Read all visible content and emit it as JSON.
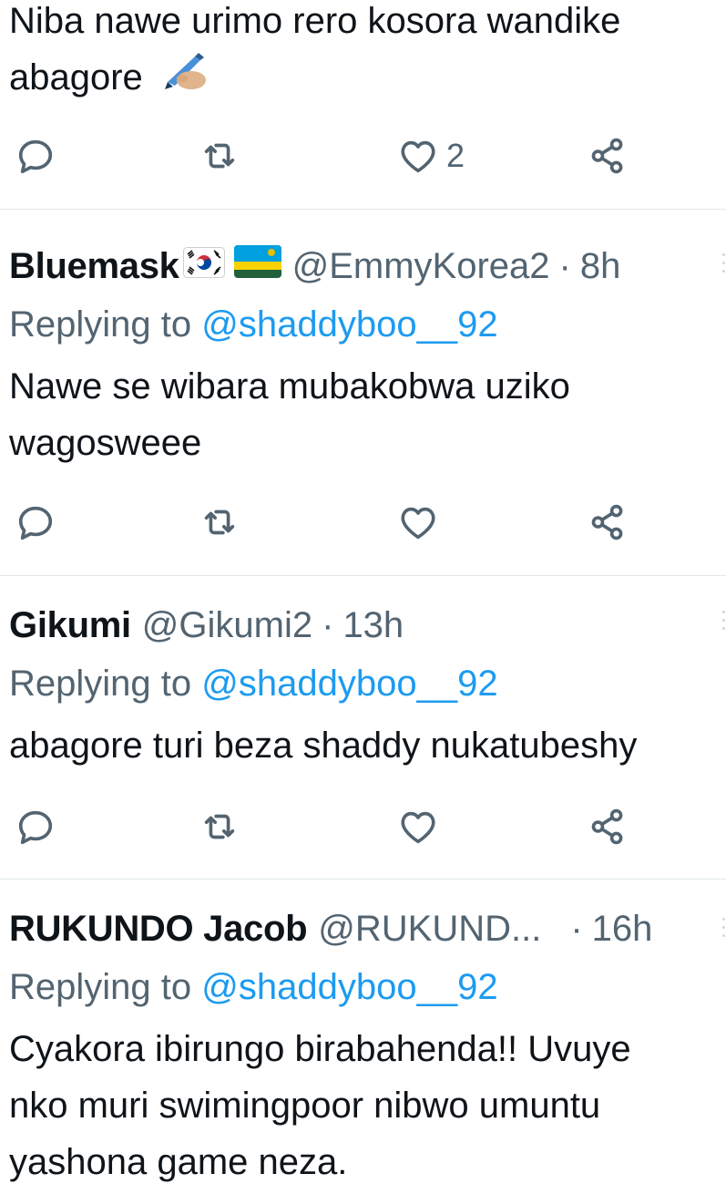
{
  "tweets": [
    {
      "body_lines": [
        "Niba nawe urimo rero kosora wandike",
        "abagore"
      ],
      "emoji": "writing-hand",
      "like_count": "2"
    },
    {
      "name": "Bluemask",
      "flags": [
        "south-korea-flag",
        "rwanda-flag"
      ],
      "handle": "@EmmyKorea2",
      "dot": "·",
      "time": "8h",
      "replying_prefix": "Replying to",
      "replying_to": "@shaddyboo__92",
      "body_lines": [
        "Nawe se wibara mubakobwa uziko",
        "wagosweee"
      ],
      "like_count": ""
    },
    {
      "name": "Gikumi",
      "handle": "@Gikumi2",
      "dot": "·",
      "time": "13h",
      "replying_prefix": "Replying to",
      "replying_to": "@shaddyboo__92",
      "body_lines": [
        "abagore turi beza shaddy nukatubeshy"
      ],
      "like_count": ""
    },
    {
      "name": "RUKUNDO Jacob",
      "handle": "@RUKUND...",
      "dot": "·",
      "time": "16h",
      "replying_prefix": "Replying to",
      "replying_to": "@shaddyboo__92",
      "body_lines": [
        "Cyakora ibirungo birabahenda!! Uvuye",
        "nko muri swimingpoor nibwo umuntu",
        "yashona game neza."
      ]
    }
  ],
  "icons": {
    "reply": "reply-bubble-icon",
    "retweet": "retweet-icon",
    "like": "heart-icon",
    "share": "share-icon"
  },
  "colors": {
    "text": "#0f1419",
    "muted": "#536471",
    "link": "#1d9bf0",
    "divider": "#e1e8ed"
  }
}
